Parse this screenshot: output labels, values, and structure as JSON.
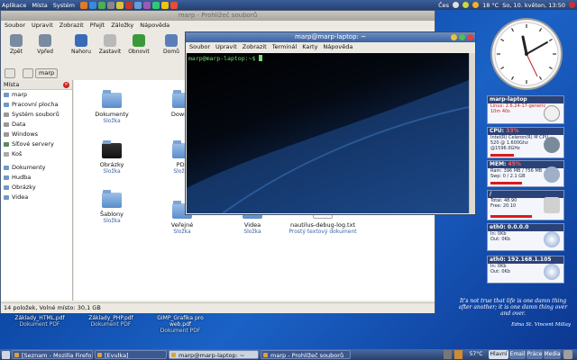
{
  "top_panel": {
    "menus": [
      "Aplikace",
      "Místa",
      "Systém"
    ],
    "keyboard_layout": "Čes",
    "temperature": "18 °C",
    "datetime": "So, 10. květen, 13:50"
  },
  "nautilus": {
    "title": "marp - Prohlížeč souborů",
    "menubar": [
      "Soubor",
      "Upravit",
      "Zobrazit",
      "Přejít",
      "Záložky",
      "Nápověda"
    ],
    "toolbar": {
      "back": "Zpět",
      "forward": "Vpřed",
      "up": "Nahoru",
      "stop": "Zastavit",
      "reload": "Obnovit",
      "home": "Domů"
    },
    "location_button": "marp",
    "sidebar": {
      "header": "Místa",
      "places": [
        "marp",
        "Pracovní plocha",
        "Systém souborů",
        "Data",
        "Windows",
        "Síťové servery",
        "Koš"
      ],
      "bookmarks": [
        "Dokumenty",
        "Hudba",
        "Obrázky",
        "Videa"
      ]
    },
    "files": [
      {
        "name": "Dokumenty",
        "type": "Složka"
      },
      {
        "name": "Downlo",
        "type": ""
      },
      {
        "name": "Obrázky",
        "type": "Složka"
      },
      {
        "name": "PDF",
        "type": "Složka"
      },
      {
        "name": "Šablony",
        "type": "Složka"
      },
      {
        "name": "Veřejné",
        "type": "Složka"
      },
      {
        "name": "Videa",
        "type": "Složka"
      },
      {
        "name": "nautilus-debug-log.txt",
        "type": "Prostý textový dokument"
      }
    ],
    "status": "14 položek, Volné místo: 30,1 GB"
  },
  "terminal": {
    "title": "marp@marp-laptop: ~",
    "menubar": [
      "Soubor",
      "Upravit",
      "Zobrazit",
      "Terminál",
      "Karty",
      "Nápověda"
    ],
    "prompt": "marp@marp-laptop:~$"
  },
  "conky": {
    "host": {
      "title": "marp-laptop",
      "lines": [
        "Linux: 2.6.24-17-generic",
        "10m 40s"
      ]
    },
    "cpu": {
      "title": "CPU:",
      "value": "33%",
      "lines": [
        "Intel(R) Celeron(R) M CPU",
        "520 @ 1.600Ghz",
        "@1596.0GHz"
      ],
      "percent": 33
    },
    "mem": {
      "title": "MEM:",
      "value": "45%",
      "lines": [
        "Ram: 396 MB / 756 MB",
        "Swp: 0 / 2.1 GB"
      ],
      "percent": 45
    },
    "disk": {
      "title": "/",
      "lines": [
        "Total: 48.90",
        "Free: 20.10"
      ],
      "percent": 59
    },
    "eth0": {
      "title": "eth0:",
      "addr": "0.0.0.0",
      "lines": [
        "In:    0Kb",
        "Out:   0Kb"
      ]
    },
    "ath0": {
      "title": "ath0:",
      "addr": "192.168.1.105",
      "lines": [
        "In:    0Kb",
        "Out:   0Kb"
      ]
    }
  },
  "quote": {
    "text": "It's not true that life is one damn thing after another; it is one damn thing over and over.",
    "author": "Edna St. Vincent Millay"
  },
  "desktop_icons": [
    {
      "name": "Základy_HTML.pdf",
      "type": "Dokument PDF"
    },
    {
      "name": "Základy_PHP.pdf",
      "type": "Dokument PDF"
    },
    {
      "name": "GIMP_Grafika pro web.pdf",
      "type": "Dokument PDF"
    }
  ],
  "taskbar": {
    "tasks": [
      "[Seznam - Mozilla Firefo...",
      "[Evulka]",
      "marp@marp-laptop: ~",
      "marp - Prohlížeč souborů"
    ],
    "cpu_temp": "57°C",
    "tray_labels": [
      "Hlavní",
      "Email",
      "Práce",
      "Media"
    ]
  },
  "colors": {
    "desktop": "#1b62c6",
    "panel": "#2e4c80",
    "terminal_prompt": "#6ee06e",
    "bar_red": "#d81c1c",
    "folder_blue": "#5a8ccc"
  }
}
